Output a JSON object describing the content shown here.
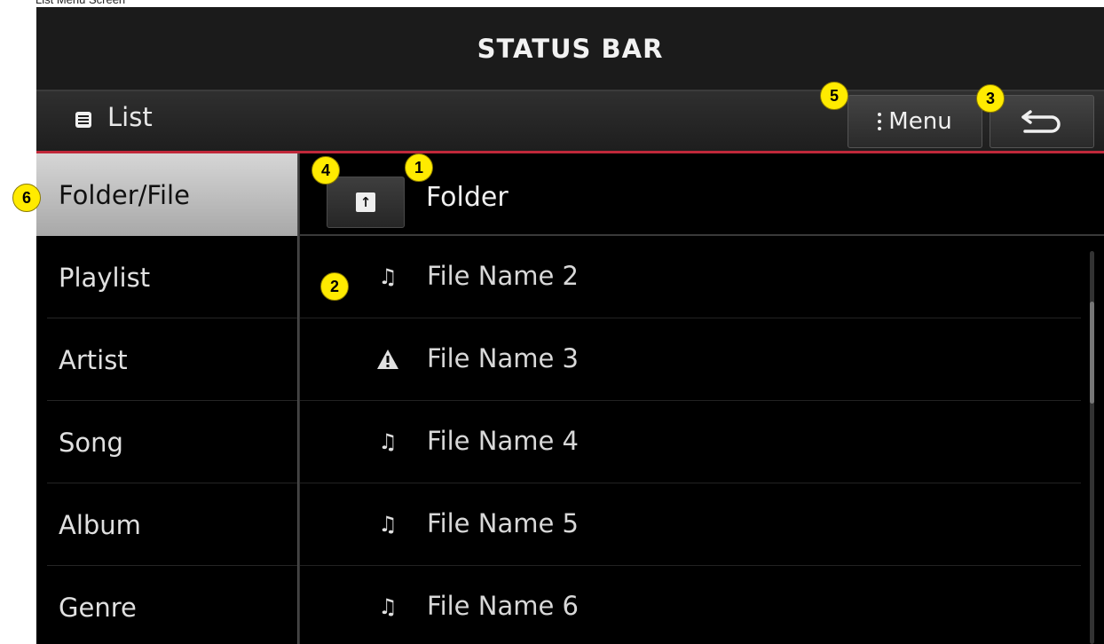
{
  "caption": "List Menu Screen",
  "status_bar": {
    "label": "STATUS BAR"
  },
  "title_bar": {
    "title": "List",
    "menu_label": "Menu"
  },
  "sidebar": {
    "items": [
      {
        "label": "Folder/File",
        "selected": true
      },
      {
        "label": "Playlist"
      },
      {
        "label": "Artist"
      },
      {
        "label": "Song"
      },
      {
        "label": "Album"
      },
      {
        "label": "Genre"
      }
    ]
  },
  "folder": {
    "name": "Folder"
  },
  "files": [
    {
      "name": "File Name 2",
      "icon": "music-note-icon"
    },
    {
      "name": "File Name 3",
      "icon": "warning-icon"
    },
    {
      "name": "File Name 4",
      "icon": "music-note-icon"
    },
    {
      "name": "File Name 5",
      "icon": "music-note-icon"
    },
    {
      "name": "File Name 6",
      "icon": "music-note-icon"
    }
  ],
  "callouts": [
    "1",
    "2",
    "3",
    "4",
    "5",
    "6"
  ],
  "colors": {
    "accent_line": "#c0283a",
    "callout_fill": "#ffeb00"
  }
}
